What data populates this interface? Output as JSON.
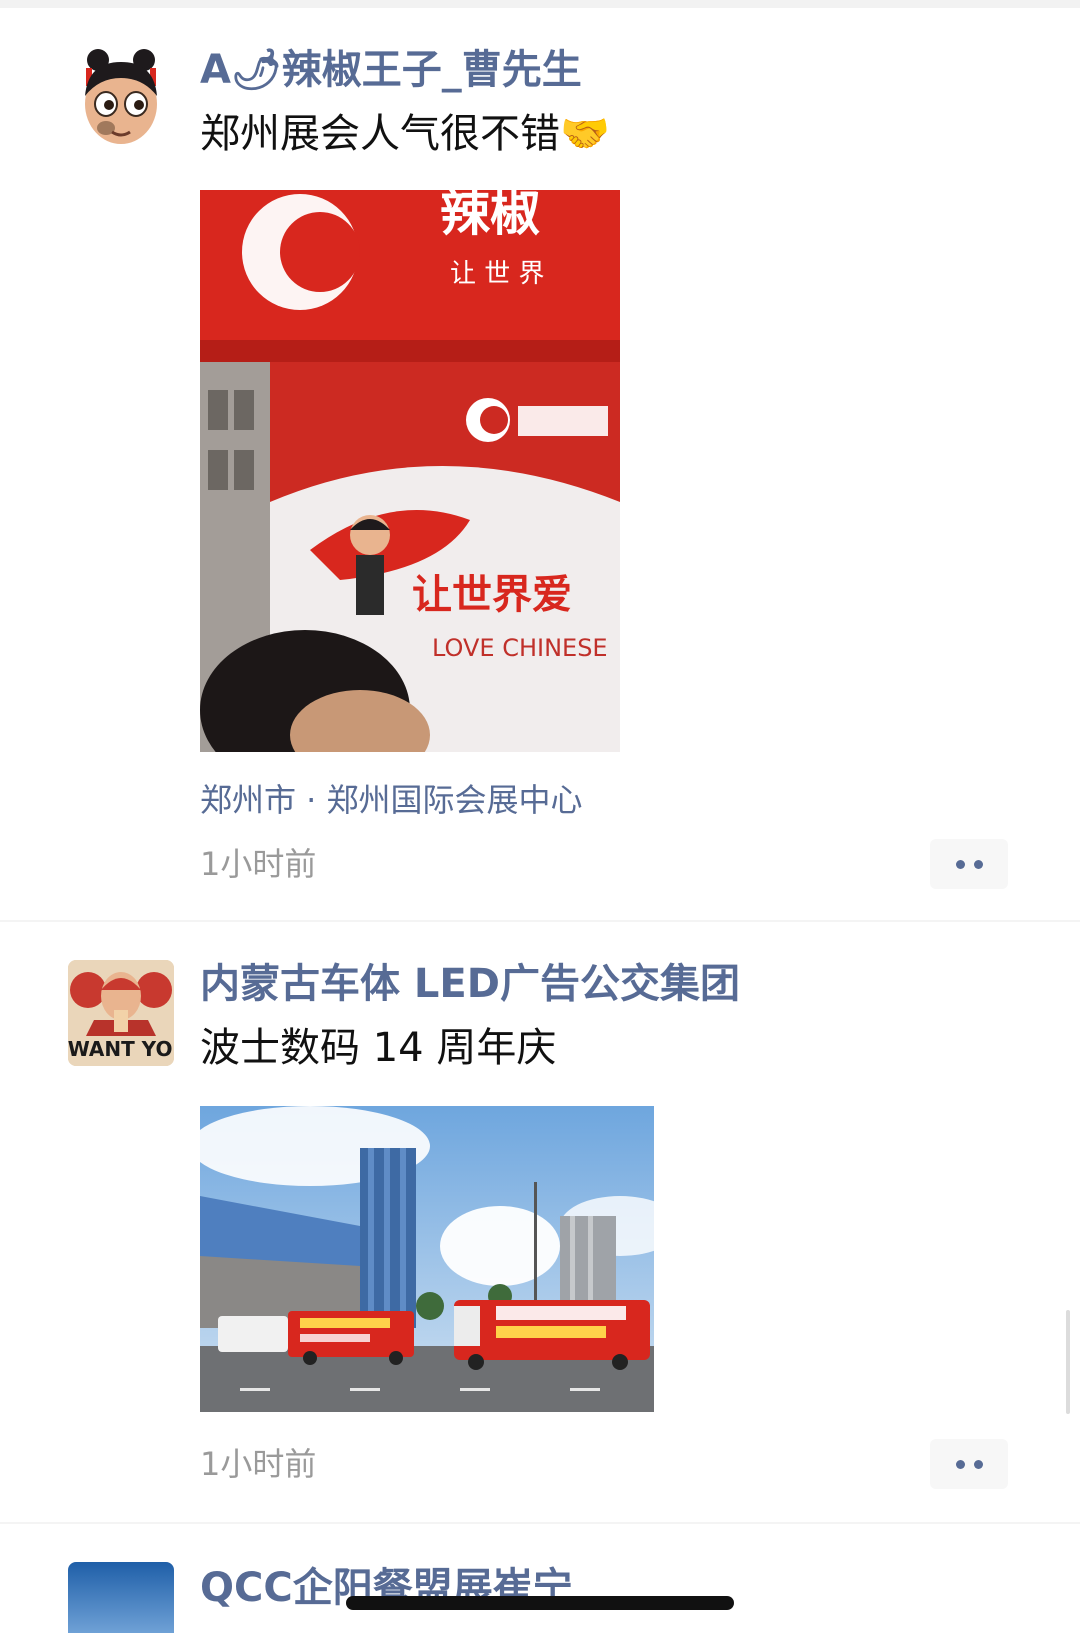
{
  "posts": [
    {
      "author": "A🌶辣椒王子_曹先生",
      "text": "郑州展会人气很不错🤝",
      "location": "郑州市 · 郑州国际会展中心",
      "time": "1小时前",
      "photo_sign_cn": "让世界爱",
      "photo_sign_en": "LOVE CHINESE",
      "photo_banner": "让 世 界"
    },
    {
      "author": "内蒙古车体 LED广告公交集团",
      "text": "波士数码 14 周年庆",
      "time": "1小时前",
      "avatar_text": "I WANT YOU"
    },
    {
      "author": "QCC企阳餐盟展崔宁"
    }
  ],
  "icons": {
    "more": "more-dots-icon"
  },
  "colors": {
    "name": "#576b95",
    "text": "#111111",
    "time": "#9a9a9a",
    "brand_red": "#d8271e"
  }
}
